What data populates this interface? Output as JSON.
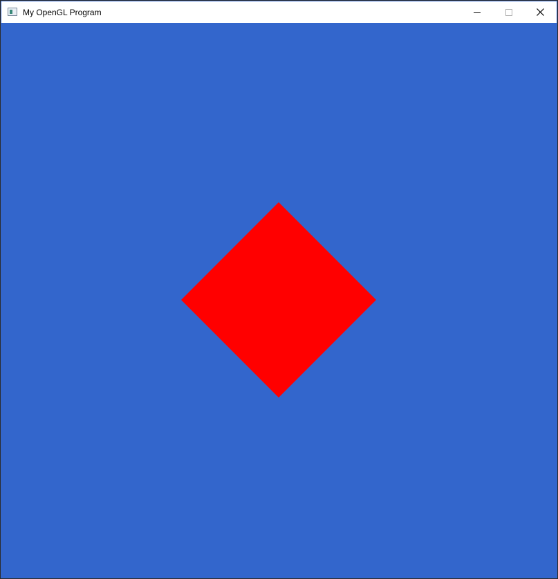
{
  "window": {
    "title": "My OpenGL Program",
    "app_icon": "application-window-icon",
    "controls": {
      "minimize_icon": "minimize-icon",
      "maximize_icon": "maximize-icon",
      "close_icon": "close-icon"
    }
  },
  "scene": {
    "clear_color": "#3366cc",
    "shape": {
      "kind": "diamond",
      "fill_color": "#ff0000"
    }
  }
}
